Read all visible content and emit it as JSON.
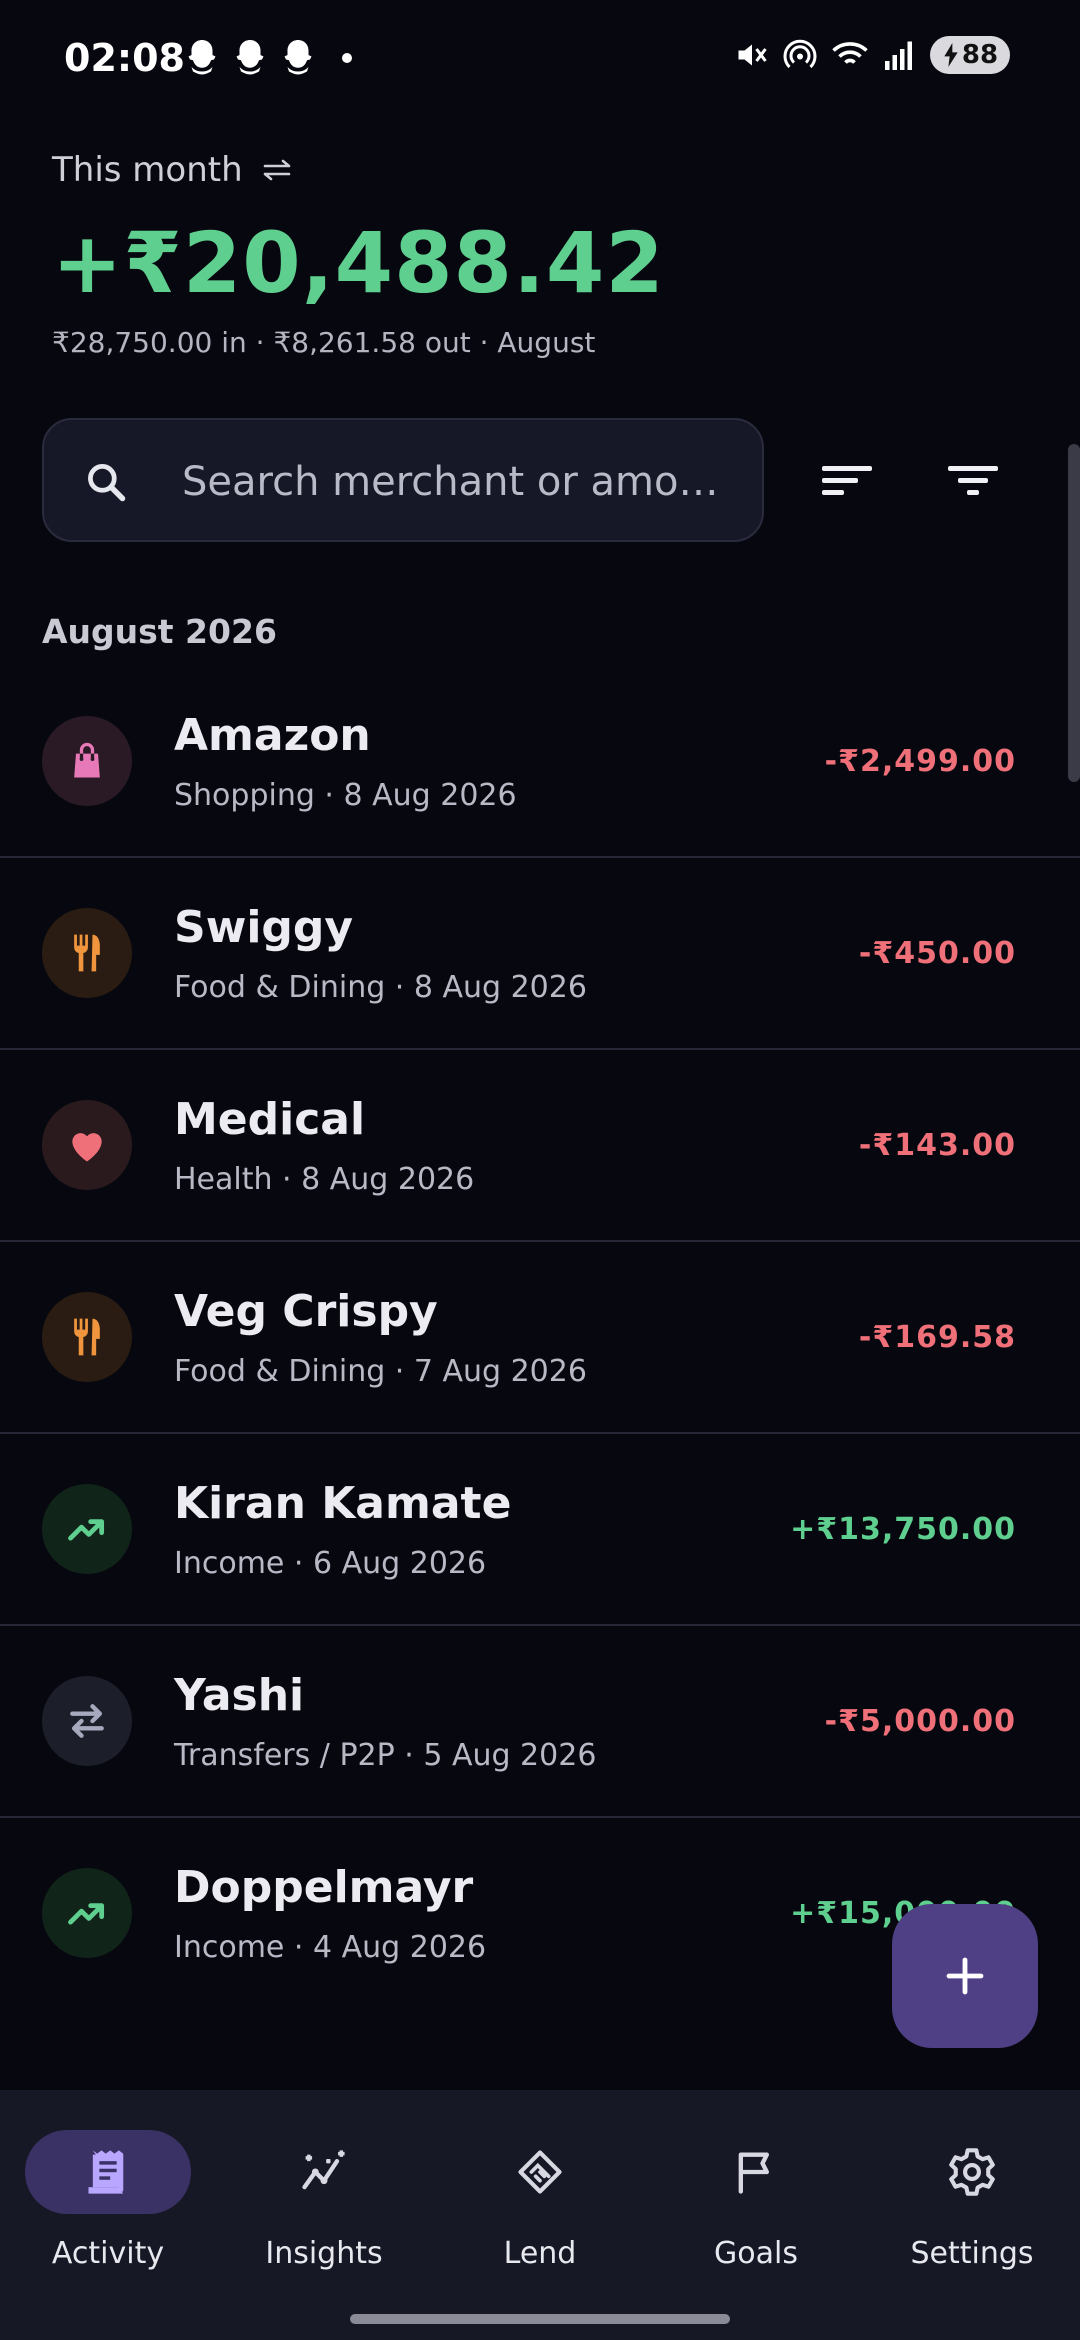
{
  "status_bar": {
    "time": "02:08",
    "battery": "88",
    "notification_icons": [
      "snapchat-icon",
      "snapchat-icon",
      "snapchat-icon"
    ],
    "system_icons": [
      "mute-icon",
      "hotspot-icon",
      "wifi-icon",
      "signal-icon",
      "battery-icon"
    ]
  },
  "header": {
    "period_label": "This month",
    "net_total": "+₹20,488.42",
    "summary": "₹28,750.00 in · ₹8,261.58 out · August"
  },
  "search": {
    "placeholder": "Search merchant or amo…"
  },
  "month_header": "August 2026",
  "transactions": [
    {
      "name": "Amazon",
      "meta": "Shopping · 8 Aug 2026",
      "amount": "-₹2,499.00",
      "icon": "shopping-bag-icon"
    },
    {
      "name": "Swiggy",
      "meta": "Food & Dining · 8 Aug 2026",
      "amount": "-₹450.00",
      "icon": "fork-knife-icon"
    },
    {
      "name": "Medical",
      "meta": "Health · 8 Aug 2026",
      "amount": "-₹143.00",
      "icon": "heart-icon"
    },
    {
      "name": "Veg Crispy",
      "meta": "Food & Dining · 7 Aug 2026",
      "amount": "-₹169.58",
      "icon": "fork-knife-icon"
    },
    {
      "name": "Kiran Kamate",
      "meta": "Income · 6 Aug 2026",
      "amount": "+₹13,750.00",
      "icon": "trending-up-icon"
    },
    {
      "name": "Yashi",
      "meta": "Transfers / P2P · 5 Aug 2026",
      "amount": "-₹5,000.00",
      "icon": "transfer-icon"
    },
    {
      "name": "Doppelmayr",
      "meta": "Income · 4 Aug 2026",
      "amount": "+₹15,000.00",
      "icon": "trending-up-icon"
    }
  ],
  "colors": {
    "income": "#5fcf8f",
    "expense": "#f0707a",
    "accent": "#4f3f84",
    "shopping": "#e879b8",
    "food": "#f0953e",
    "health": "#f0707a",
    "transfer": "#a6a9bd"
  },
  "bottom_nav": [
    {
      "label": "Activity",
      "icon": "receipt-icon",
      "active": true
    },
    {
      "label": "Insights",
      "icon": "insights-icon",
      "active": false
    },
    {
      "label": "Lend",
      "icon": "handshake-icon",
      "active": false
    },
    {
      "label": "Goals",
      "icon": "flag-icon",
      "active": false
    },
    {
      "label": "Settings",
      "icon": "gear-icon",
      "active": false
    }
  ]
}
